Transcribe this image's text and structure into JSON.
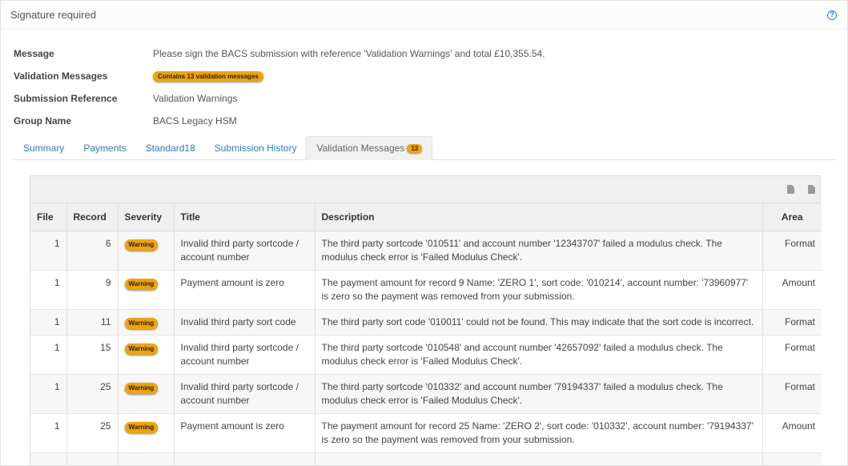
{
  "header": {
    "title": "Signature required",
    "help_icon": "question-circle-icon"
  },
  "info": {
    "message_label": "Message",
    "message_value": "Please sign the BACS submission with reference 'Validation Warnings' and total £10,355.54.",
    "validation_label": "Validation Messages",
    "validation_badge": "Contains 13 validation messages",
    "reference_label": "Submission Reference",
    "reference_value": "Validation Warnings",
    "group_label": "Group Name",
    "group_value": "BACS Legacy HSM"
  },
  "tabs": [
    {
      "label": "Summary"
    },
    {
      "label": "Payments"
    },
    {
      "label": "Standard18"
    },
    {
      "label": "Submission History"
    },
    {
      "label": "Validation Messages",
      "count": "13"
    }
  ],
  "toolbar": {
    "icons": [
      "export-csv-icon",
      "export-excel-icon"
    ]
  },
  "table": {
    "headers": [
      "File",
      "Record",
      "Severity",
      "Title",
      "Description",
      "Area"
    ],
    "rows": [
      {
        "file": "1",
        "record": "6",
        "severity": "Warning",
        "title": "Invalid third party sortcode / account number",
        "description": "The third party sortcode '010511' and account number '12343707' failed a modulus check. The modulus check error is 'Failed Modulus Check'.",
        "area": "Format"
      },
      {
        "file": "1",
        "record": "9",
        "severity": "Warning",
        "title": "Payment amount is zero",
        "description": "The payment amount for record 9 Name: 'ZERO 1', sort code: '010214', account number: '73960977' is zero so the payment was removed from your submission.",
        "area": "Amount"
      },
      {
        "file": "1",
        "record": "11",
        "severity": "Warning",
        "title": "Invalid third party sort code",
        "description": "The third party sort code '010011' could not be found. This may indicate that the sort code is incorrect.",
        "area": "Format"
      },
      {
        "file": "1",
        "record": "15",
        "severity": "Warning",
        "title": "Invalid third party sortcode / account number",
        "description": "The third party sortcode '010548' and account number '42657092' failed a modulus check. The modulus check error is 'Failed Modulus Check'.",
        "area": "Format"
      },
      {
        "file": "1",
        "record": "25",
        "severity": "Warning",
        "title": "Invalid third party sortcode / account number",
        "description": "The third party sortcode '010332' and account number '79194337' failed a modulus check. The modulus check error is 'Failed Modulus Check'.",
        "area": "Format"
      },
      {
        "file": "1",
        "record": "25",
        "severity": "Warning",
        "title": "Payment amount is zero",
        "description": "The payment amount for record 25 Name: 'ZERO 2', sort code: '010332', account number: '79194337' is zero so the payment was removed from your submission.",
        "area": "Amount"
      }
    ]
  },
  "colors": {
    "accent": "#337ab7",
    "badge": "#f0a30a"
  }
}
